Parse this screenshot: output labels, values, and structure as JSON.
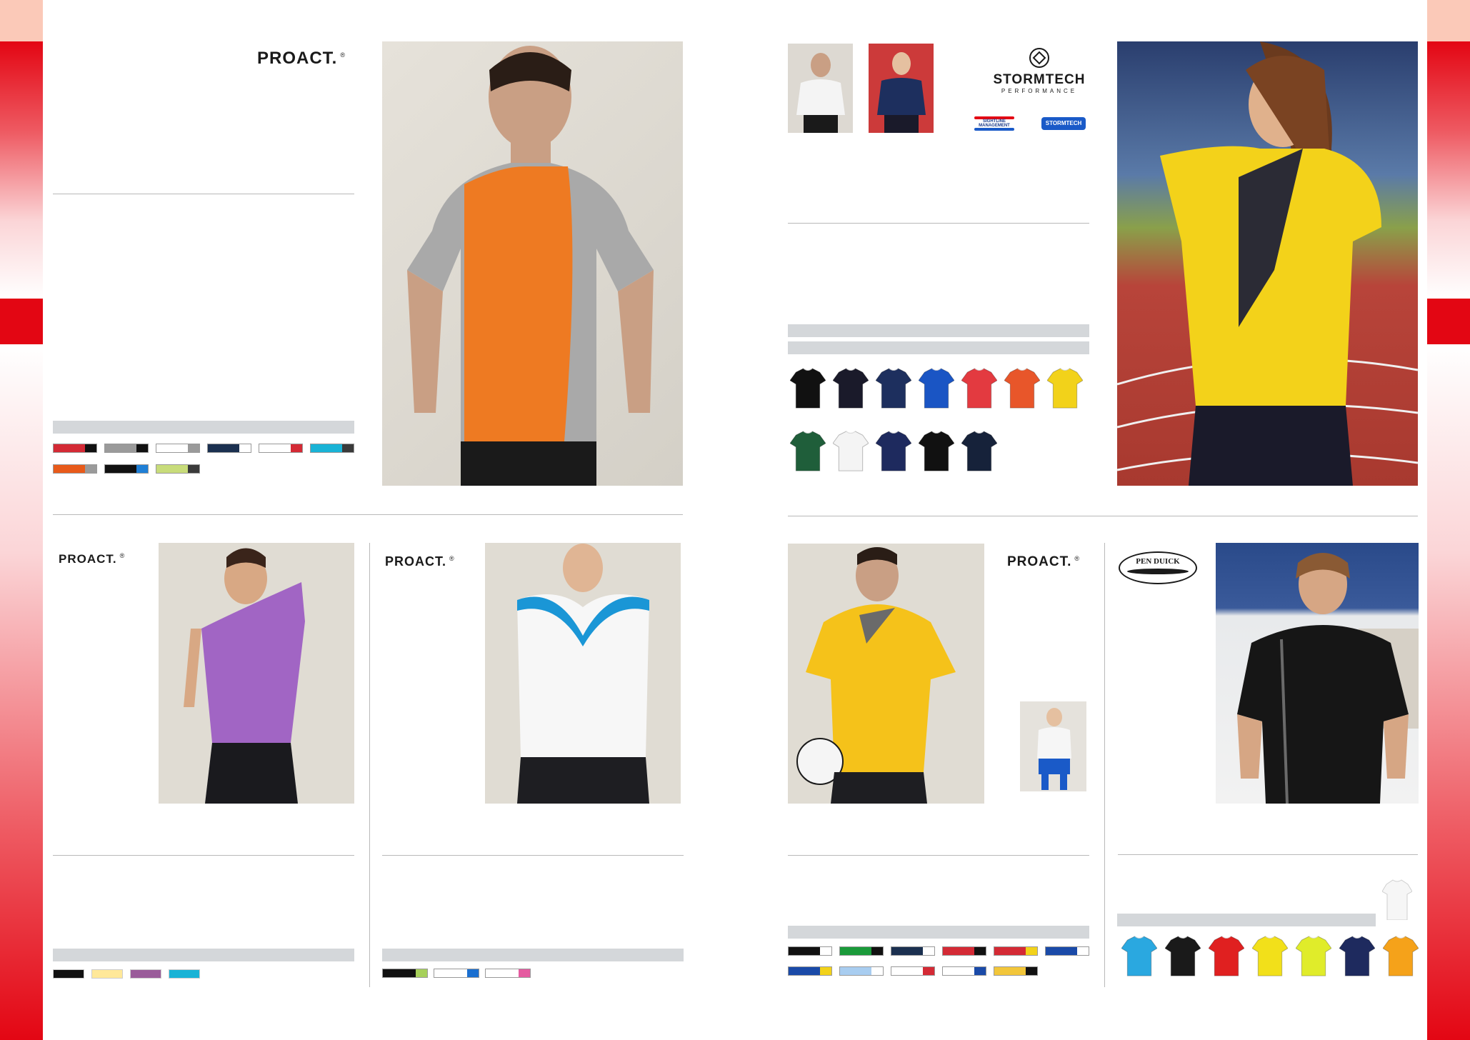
{
  "logos": {
    "proact": "PROACT.",
    "proact_reg": "®",
    "stormtech": "STORMTECH",
    "stormtech_sub": "PERFORMANCE",
    "stormtech_badge_1": "SIGHTLINE MANAGEMENT",
    "stormtech_badge_2": "STORMTECH",
    "penduick": "PEN DUICK"
  },
  "colors": {
    "brand_red": "#e30613",
    "divider": "#b8b8b8",
    "label_bar": "#d4d7da"
  },
  "product_1_swatches": [
    {
      "main": "#d42a35",
      "accent": "#111111"
    },
    {
      "main": "#9a9a9a",
      "accent": "#111111"
    },
    {
      "main": "#ffffff",
      "accent": "#9a9a9a"
    },
    {
      "main": "#1b3050",
      "accent": "#ffffff"
    },
    {
      "main": "#ffffff",
      "accent": "#d42a35"
    },
    {
      "main": "#19b3d6",
      "accent": "#3a3a3a"
    },
    {
      "main": "#e85a1a",
      "accent": "#9a9a9a"
    },
    {
      "main": "#111111",
      "accent": "#1f7fd6"
    },
    {
      "main": "#c8dc7a",
      "accent": "#3a3a3a"
    }
  ],
  "product_2_shirts": [
    "#111111",
    "#1a1a2a",
    "#1d2f5e",
    "#1a55c4",
    "#e33a40",
    "#e8562a",
    "#f2d21a",
    "#1f5e3a",
    "#f4f4f4",
    "#1e2a5e",
    "#111111",
    "#16223a"
  ],
  "product_3_swatches": [
    "#111111",
    "#ffe899",
    "#9a5c9a",
    "#19b3d6"
  ],
  "product_4_swatches": [
    {
      "main": "#111111",
      "accent": "#a6d05a"
    },
    {
      "main": "#ffffff",
      "accent": "#1a6fd0"
    },
    {
      "main": "#ffffff",
      "accent": "#e55aa0"
    }
  ],
  "product_5_swatches": [
    {
      "main": "#111111",
      "accent": "#ffffff"
    },
    {
      "main": "#1a9a3a",
      "accent": "#111111"
    },
    {
      "main": "#1b3050",
      "accent": "#ffffff"
    },
    {
      "main": "#d42a35",
      "accent": "#111111"
    },
    {
      "main": "#d42a35",
      "accent": "#f2d21a"
    },
    {
      "main": "#1a4aa8",
      "accent": "#ffffff"
    },
    {
      "main": "#1a4aa8",
      "accent": "#f2d21a"
    },
    {
      "main": "#a8cdf0",
      "accent": "#ffffff"
    },
    {
      "main": "#ffffff",
      "accent": "#d42a35"
    },
    {
      "main": "#ffffff",
      "accent": "#1a4aa8"
    },
    {
      "main": "#f2c63a",
      "accent": "#111111"
    }
  ],
  "product_6_shirts": [
    "#2aa8e0",
    "#1a1a1a",
    "#e02020",
    "#f2e01a",
    "#e0ec2a",
    "#1e2a5e",
    "#f5a21a"
  ]
}
